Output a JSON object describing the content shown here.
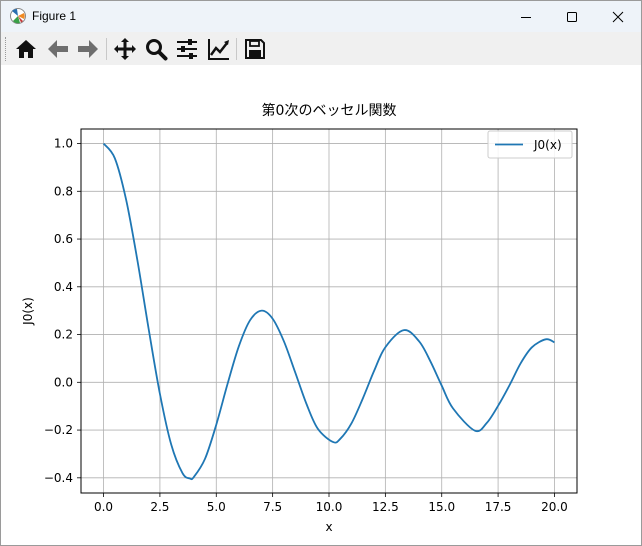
{
  "window": {
    "title": "Figure 1"
  },
  "toolbar": {
    "icons": [
      "home-icon",
      "back-arrow-icon",
      "forward-arrow-icon",
      "pan-icon",
      "zoom-icon",
      "configure-subplots-icon",
      "edit-axis-icon",
      "save-icon"
    ]
  },
  "colors": {
    "line": "#1f77b4",
    "grid": "#b0b0b0",
    "titlebar": "#eef3f9",
    "toolbar": "#f0f0f0"
  },
  "chart_data": {
    "type": "line",
    "title": "第0次のベッセル関数",
    "xlabel": "x",
    "ylabel": "J0(x)",
    "xlim": [
      -1.0,
      21.0
    ],
    "ylim": [
      -0.4636,
      1.0609
    ],
    "xticks": [
      0.0,
      2.5,
      5.0,
      7.5,
      10.0,
      12.5,
      15.0,
      17.5,
      20.0
    ],
    "xtick_labels": [
      "0.0",
      "2.5",
      "5.0",
      "7.5",
      "10.0",
      "12.5",
      "15.0",
      "17.5",
      "20.0"
    ],
    "yticks": [
      -0.4,
      -0.2,
      0.0,
      0.2,
      0.4,
      0.6,
      0.8,
      1.0
    ],
    "ytick_labels": [
      "−0.4",
      "−0.2",
      "0.0",
      "0.2",
      "0.4",
      "0.6",
      "0.8",
      "1.0"
    ],
    "grid": true,
    "legend": {
      "position": "top-right",
      "entries": [
        "J0(x)"
      ]
    },
    "series": [
      {
        "name": "J0(x)",
        "x": [
          0,
          0.5,
          1,
          1.5,
          2,
          2.5,
          3,
          3.5,
          3.8317,
          4,
          4.5,
          5,
          5.5,
          6,
          6.5,
          7.0156,
          7.5,
          8,
          8.5,
          9,
          9.5,
          10.1735,
          10.5,
          11,
          11.5,
          12,
          12.5,
          13.3237,
          14,
          14.5,
          15,
          15.5,
          16.4706,
          17,
          17.5,
          18,
          18.5,
          19,
          19.6159,
          20
        ],
        "y": [
          1.0,
          0.9385,
          0.7652,
          0.5118,
          0.2239,
          -0.0484,
          -0.2601,
          -0.3801,
          -0.4028,
          -0.3971,
          -0.3205,
          -0.1776,
          -0.0068,
          0.1506,
          0.2601,
          0.3001,
          0.2663,
          0.1717,
          0.0419,
          -0.0903,
          -0.1939,
          -0.2497,
          -0.2367,
          -0.1712,
          -0.0677,
          0.0477,
          0.1469,
          0.2184,
          0.1711,
          0.0875,
          -0.0142,
          -0.1092,
          -0.2026,
          -0.1699,
          -0.0984,
          -0.0134,
          0.0796,
          0.1466,
          0.1801,
          0.167
        ]
      }
    ]
  }
}
